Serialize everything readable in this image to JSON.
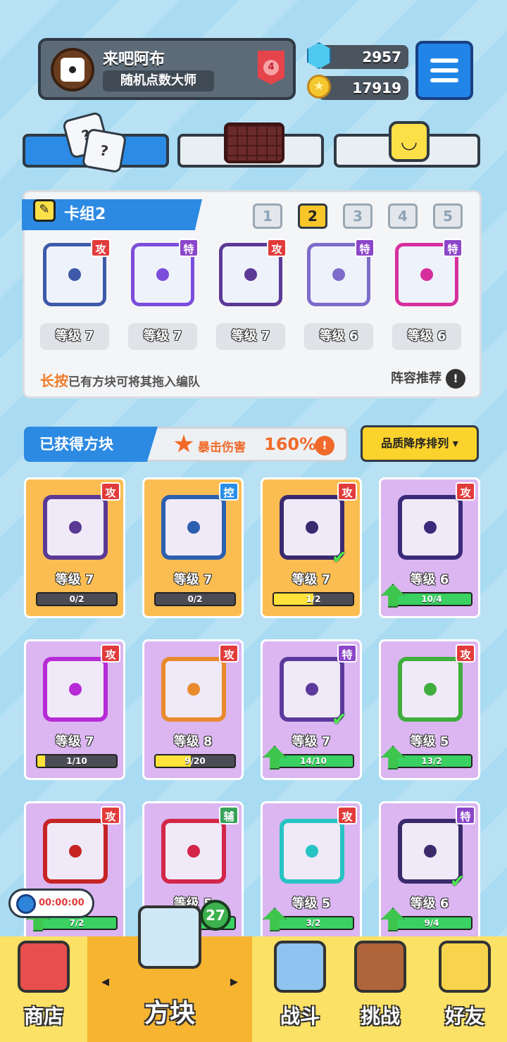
{
  "profile": {
    "name": "来吧阿布",
    "title": "随机点数大师",
    "rank": "4"
  },
  "currency": {
    "gems": "2957",
    "coins": "17919"
  },
  "deck": {
    "label": "卡组2",
    "numbers": [
      "1",
      "2",
      "3",
      "4",
      "5"
    ],
    "active": "2",
    "cards": [
      {
        "type": "攻",
        "level": "等级 7",
        "color": "#3e5aa8",
        "tag": "red",
        "icon": "gears-die-icon"
      },
      {
        "type": "特",
        "level": "等级 7",
        "color": "#7c4ddb",
        "tag": "purple",
        "icon": "rainbow-die-icon"
      },
      {
        "type": "攻",
        "level": "等级 7",
        "color": "#5b3a96",
        "tag": "red",
        "icon": "dragon-die-icon"
      },
      {
        "type": "特",
        "level": "等级 6",
        "color": "#7d6cc9",
        "tag": "purple",
        "icon": "crack-die-icon"
      },
      {
        "type": "特",
        "level": "等级 6",
        "color": "#d62f9d",
        "tag": "purple",
        "icon": "arrow-die-icon"
      }
    ],
    "hint_bold": "长按",
    "hint_rest": "已有方块可将其拖入编队",
    "recommend": "阵容推荐"
  },
  "obtained": {
    "label": "已获得方块",
    "crit_label": "暴击伤害",
    "crit_value": "160%",
    "sort": "品质降序排列 ▾"
  },
  "blocks": [
    {
      "type": "攻",
      "tag": "red",
      "level": "等级 7",
      "progress": "0/2",
      "fill": 0,
      "bg": "gold",
      "border": "#5b3a96",
      "up": false,
      "check": false
    },
    {
      "type": "控",
      "tag": "blue",
      "level": "等级 7",
      "progress": "0/2",
      "fill": 0,
      "bg": "gold",
      "border": "#2c5fb0",
      "up": false,
      "check": false
    },
    {
      "type": "攻",
      "tag": "red",
      "level": "等级 7",
      "progress": "1/2",
      "fill": 0.5,
      "bg": "gold",
      "border": "#3a2870",
      "up": false,
      "check": true
    },
    {
      "type": "攻",
      "tag": "red",
      "level": "等级 6",
      "progress": "10/4",
      "fill": 1,
      "bg": "lav",
      "border": "#3b2a7a",
      "up": true,
      "check": false
    },
    {
      "type": "攻",
      "tag": "red",
      "level": "等级 7",
      "progress": "1/10",
      "fill": 0.1,
      "bg": "lav",
      "border": "#b62bd6",
      "up": false,
      "check": false
    },
    {
      "type": "攻",
      "tag": "red",
      "level": "等级 8",
      "progress": "9/20",
      "fill": 0.45,
      "bg": "lav",
      "border": "#e98a2d",
      "up": false,
      "check": false
    },
    {
      "type": "特",
      "tag": "purple",
      "level": "等级 7",
      "progress": "14/10",
      "fill": 1,
      "bg": "lav",
      "border": "#5c3a9c",
      "up": true,
      "check": true
    },
    {
      "type": "攻",
      "tag": "red",
      "level": "等级 5",
      "progress": "13/2",
      "fill": 1,
      "bg": "lav",
      "border": "#3fae3d",
      "up": true,
      "check": false
    },
    {
      "type": "攻",
      "tag": "red",
      "level": "",
      "progress": "7/2",
      "fill": 1,
      "bg": "lav",
      "border": "#c62424",
      "up": true,
      "check": false
    },
    {
      "type": "辅",
      "tag": "green",
      "level": "等级 5",
      "progress": "",
      "fill": 1,
      "bg": "lav",
      "border": "#d32648",
      "up": true,
      "check": false
    },
    {
      "type": "攻",
      "tag": "red",
      "level": "等级 5",
      "progress": "3/2",
      "fill": 1,
      "bg": "lav",
      "border": "#27c3c3",
      "up": true,
      "check": false
    },
    {
      "type": "特",
      "tag": "purple",
      "level": "等级 6",
      "progress": "9/4",
      "fill": 1,
      "bg": "lav",
      "border": "#3a2a6c",
      "up": true,
      "check": true
    }
  ],
  "timer": "00:00:00",
  "nav": {
    "shop": "商店",
    "blocks": "方块",
    "battle": "战斗",
    "challenge": "挑战",
    "friends": "好友",
    "badge": "27"
  }
}
